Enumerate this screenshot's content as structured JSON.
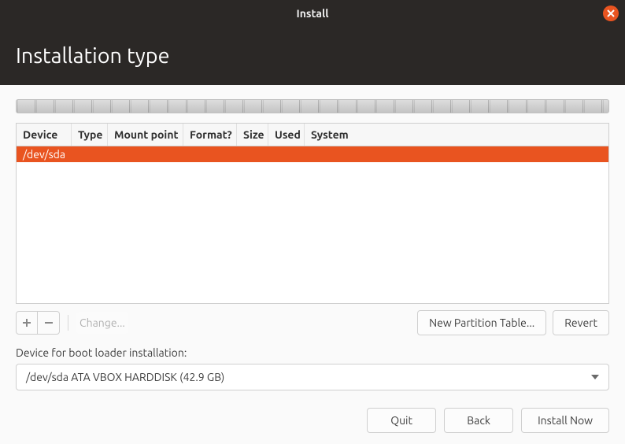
{
  "window": {
    "title": "Install",
    "heading": "Installation type"
  },
  "table": {
    "columns": [
      "Device",
      "Type",
      "Mount point",
      "Format?",
      "Size",
      "Used",
      "System"
    ],
    "rows": [
      {
        "device": "/dev/sda",
        "type": "",
        "mount": "",
        "format": "",
        "size": "",
        "used": "",
        "system": ""
      }
    ]
  },
  "table_toolbar": {
    "add": "+",
    "remove": "−",
    "change": "Change...",
    "new_table": "New Partition Table...",
    "revert": "Revert"
  },
  "bootloader": {
    "label": "Device for boot loader installation:",
    "selected": "/dev/sda   ATA VBOX HARDDISK (42.9 GB)"
  },
  "nav": {
    "quit": "Quit",
    "back": "Back",
    "install": "Install Now"
  }
}
